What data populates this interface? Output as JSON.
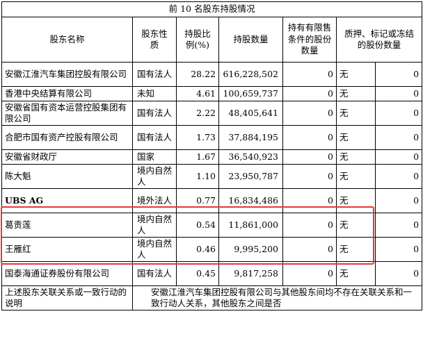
{
  "caption": "前 10 名股东持股情况",
  "headers": {
    "name": "股东名称",
    "nature": "股东性质",
    "ratio": "持股比例(%)",
    "shares": "持股数量",
    "restricted": "持有有限售条件的股份数量",
    "pledge": "质押、标记或冻结的股份数量"
  },
  "rows": [
    {
      "name": "安徽江淮汽车集团控股有限公司",
      "nature": "国有法人",
      "ratio": "28.22",
      "shares": "616,228,502",
      "restricted": "0",
      "pledge_status": "无",
      "pledge_qty": "0"
    },
    {
      "name": "香港中央结算有限公司",
      "nature": "未知",
      "ratio": "4.61",
      "shares": "100,659,737",
      "restricted": "0",
      "pledge_status": "无",
      "pledge_qty": "0"
    },
    {
      "name": "安徽省国有资本运营控股集团有限公司",
      "nature": "国有法人",
      "ratio": "2.22",
      "shares": "48,405,641",
      "restricted": "0",
      "pledge_status": "无",
      "pledge_qty": "0"
    },
    {
      "name": "合肥市国有资产控股有限公司",
      "nature": "国有法人",
      "ratio": "1.73",
      "shares": "37,884,195",
      "restricted": "0",
      "pledge_status": "无",
      "pledge_qty": "0"
    },
    {
      "name": "安徽省财政厅",
      "nature": "国家",
      "ratio": "1.67",
      "shares": "36,540,923",
      "restricted": "0",
      "pledge_status": "无",
      "pledge_qty": "0"
    },
    {
      "name": "陈大魁",
      "nature": "境内自然人",
      "ratio": "1.10",
      "shares": "23,950,787",
      "restricted": "0",
      "pledge_status": "无",
      "pledge_qty": "0"
    },
    {
      "name": "UBS AG",
      "nature": "境外法人",
      "ratio": "0.77",
      "shares": "16,834,486",
      "restricted": "0",
      "pledge_status": "无",
      "pledge_qty": "0"
    },
    {
      "name": "葛贵莲",
      "nature": "境内自然人",
      "ratio": "0.54",
      "shares": "11,861,000",
      "restricted": "0",
      "pledge_status": "无",
      "pledge_qty": "0"
    },
    {
      "name": "王雁红",
      "nature": "境内自然人",
      "ratio": "0.46",
      "shares": "9,995,200",
      "restricted": "0",
      "pledge_status": "无",
      "pledge_qty": "0"
    },
    {
      "name": "国泰海通证券股份有限公司",
      "nature": "国有法人",
      "ratio": "0.45",
      "shares": "9,817,258",
      "restricted": "0",
      "pledge_status": "无",
      "pledge_qty": "0"
    }
  ],
  "relation": {
    "label": "上述股东关联关系或一致行动的说明",
    "text": "安徽江淮汽车集团控股有限公司与其他股东间均不存在关联关系和一致行动人关系，其他股东之间是否"
  },
  "colors": {
    "highlight": "#e53935"
  }
}
